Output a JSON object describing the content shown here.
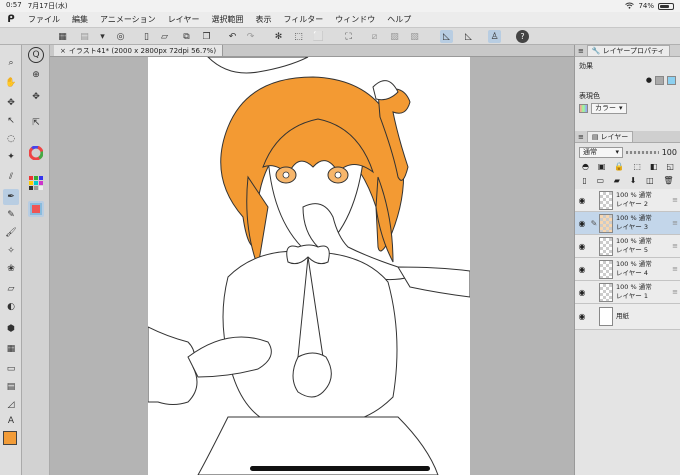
{
  "status": {
    "time": "0:57",
    "date": "7月17日(水)",
    "battery": "74%",
    "battery_level": 0.74
  },
  "menu": [
    "ファイル",
    "編集",
    "アニメーション",
    "レイヤー",
    "選択範囲",
    "表示",
    "フィルター",
    "ウィンドウ",
    "ヘルプ"
  ],
  "document": {
    "tab_label": "イラスト41* (2000 x 2800px 72dpi 56.7%)"
  },
  "layer_property": {
    "tab_label": "レイヤープロパティ",
    "effect_label": "効果",
    "display_color_label": "表現色",
    "display_color_value": "カラー"
  },
  "layers_panel": {
    "tab_label": "レイヤー",
    "blend_mode": "通常",
    "opacity": "100"
  },
  "layers": [
    {
      "line1": "100 % 通常",
      "line2": "レイヤー 2",
      "active": false,
      "editing": false,
      "thumb": "transparent"
    },
    {
      "line1": "100 % 通常",
      "line2": "レイヤー 3",
      "active": true,
      "editing": true,
      "thumb": "orange"
    },
    {
      "line1": "100 % 通常",
      "line2": "レイヤー 5",
      "active": false,
      "editing": false,
      "thumb": "transparent"
    },
    {
      "line1": "100 % 通常",
      "line2": "レイヤー 4",
      "active": false,
      "editing": false,
      "thumb": "transparent"
    },
    {
      "line1": "100 % 通常",
      "line2": "レイヤー 1",
      "active": false,
      "editing": false,
      "thumb": "transparent"
    },
    {
      "line1": "",
      "line2": "用紙",
      "active": false,
      "editing": false,
      "thumb": "paper"
    }
  ],
  "colors": {
    "main_color": "#f29c38",
    "hair": "#f39a33",
    "accent": "#b8cde2"
  },
  "icons": {
    "app": "clip-studio-logo",
    "tools": [
      "zoom-icon",
      "hand-icon",
      "move-icon",
      "select-icon",
      "lasso-icon",
      "eyedropper-icon",
      "pen-icon",
      "brush-icon",
      "eraser-icon",
      "fill-icon",
      "gradient-icon",
      "shape-icon",
      "ruler-icon",
      "text-icon",
      "balloon-icon",
      "correct-line-icon"
    ]
  }
}
